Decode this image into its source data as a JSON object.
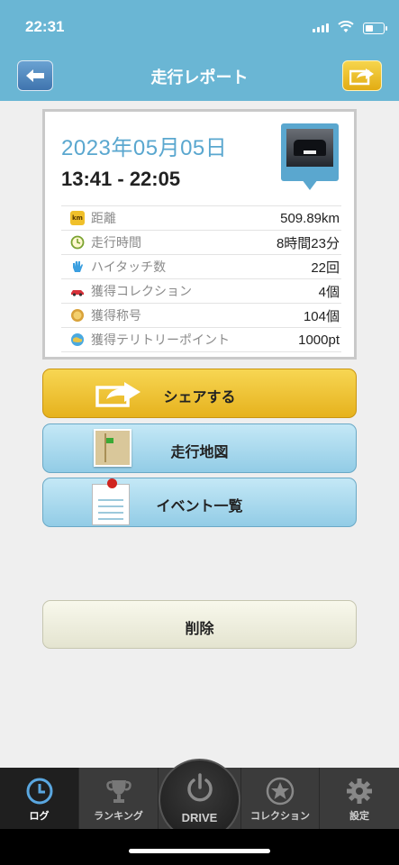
{
  "status": {
    "time": "22:31"
  },
  "nav": {
    "title": "走行レポート"
  },
  "report": {
    "date": "2023年05月05日",
    "time_range": "13:41 - 22:05",
    "rows": [
      {
        "icon": "km-icon",
        "label": "距離",
        "value": "509.89km"
      },
      {
        "icon": "clock-icon",
        "label": "走行時間",
        "value": "8時間23分"
      },
      {
        "icon": "hand-icon",
        "label": "ハイタッチ数",
        "value": "22回"
      },
      {
        "icon": "car-icon",
        "label": "獲得コレクション",
        "value": "4個"
      },
      {
        "icon": "medal-icon",
        "label": "獲得称号",
        "value": "104個"
      },
      {
        "icon": "globe-icon",
        "label": "獲得テリトリーポイント",
        "value": "1000pt"
      }
    ],
    "km_badge": "km"
  },
  "actions": {
    "share": "シェアする",
    "map": "走行地図",
    "events": "イベント一覧",
    "delete": "削除"
  },
  "tabs": {
    "log": "ログ",
    "ranking": "ランキング",
    "drive": "DRIVE",
    "collection": "コレクション",
    "settings": "設定"
  },
  "colors": {
    "header": "#6ab6d4",
    "accent_blue": "#5aa7cf",
    "share_yellow": "#f0c53a",
    "tab_bg": "#3b3b3b"
  }
}
